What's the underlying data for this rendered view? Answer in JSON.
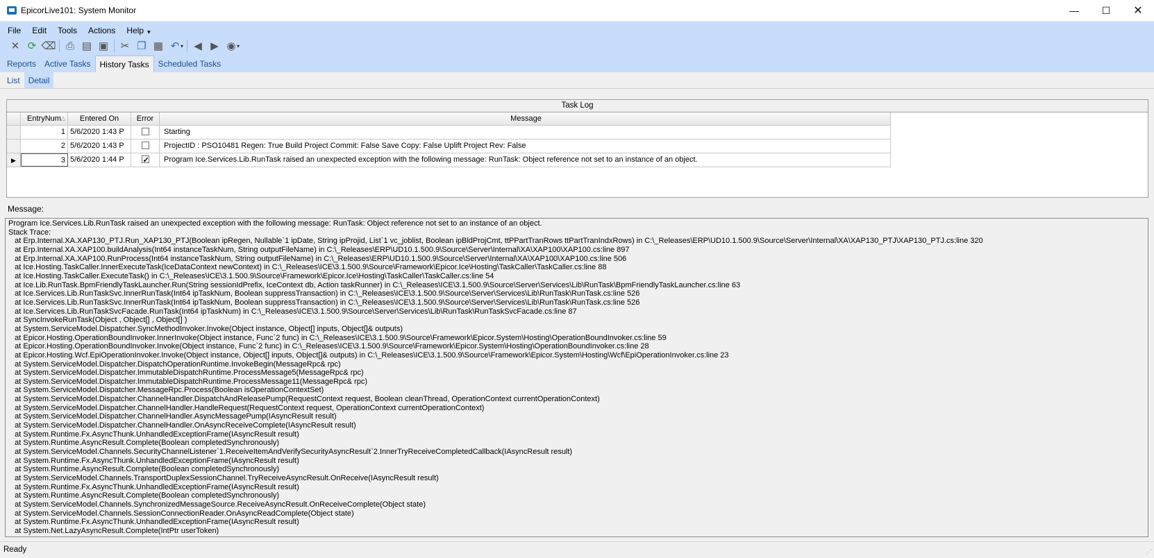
{
  "window": {
    "title": "EpicorLive101: System Monitor",
    "minimize_glyph": "—",
    "maximize_glyph": "☐",
    "close_glyph": "✕"
  },
  "menu": {
    "file": "File",
    "edit": "Edit",
    "tools": "Tools",
    "actions": "Actions",
    "help": "Help"
  },
  "toolbar": {
    "icons": [
      "delete-icon",
      "refresh-icon",
      "clear-icon",
      "print-icon",
      "print-preview-icon",
      "save-icon",
      "cut-icon",
      "copy-icon",
      "paste-icon",
      "undo-icon",
      "back-icon",
      "forward-icon",
      "home-icon"
    ]
  },
  "top_tabs": [
    {
      "label": "Reports"
    },
    {
      "label": "Active Tasks"
    },
    {
      "label": "History Tasks",
      "active": true
    },
    {
      "label": "Scheduled Tasks"
    }
  ],
  "sub_tabs": [
    {
      "label": "List"
    },
    {
      "label": "Detail",
      "active": true
    }
  ],
  "task_log": {
    "title": "Task Log",
    "columns": [
      "EntryNum",
      "Entered On",
      "Error",
      "Message"
    ],
    "rows": [
      {
        "entry": "1",
        "entered_on": "5/6/2020 1:43 P",
        "error": false,
        "message": "Starting"
      },
      {
        "entry": "2",
        "entered_on": "5/6/2020 1:43 P",
        "error": false,
        "message": "ProjectID : PSO10481 Regen: True Build Project Commit: False Save Copy: False Uplift Project Rev: False"
      },
      {
        "entry": "3",
        "entered_on": "5/6/2020 1:44 P",
        "error": true,
        "message": "Program Ice.Services.Lib.RunTask raised an unexpected exception with the following message: RunTask: Object reference not set to an instance of an object."
      }
    ]
  },
  "message": {
    "label": "Message:",
    "lines": [
      "Program Ice.Services.Lib.RunTask raised an unexpected exception with the following message: RunTask: Object reference not set to an instance of an object.",
      "Stack Trace:",
      "   at Erp.Internal.XA.XAP130_PTJ.Run_XAP130_PTJ(Boolean ipRegen, Nullable`1 ipDate, String ipProjid, List`1 vc_joblist, Boolean ipBldProjCmt, ttPPartTranRows ttPartTranIndxRows) in C:\\_Releases\\ERP\\UD10.1.500.9\\Source\\Server\\Internal\\XA\\XAP130_PTJ\\XAP130_PTJ.cs:line 320",
      "   at Erp.Internal.XA.XAP100.buildAnalysis(Int64 instanceTaskNum, String outputFileName) in C:\\_Releases\\ERP\\UD10.1.500.9\\Source\\Server\\Internal\\XA\\XAP100\\XAP100.cs:line 897",
      "   at Erp.Internal.XA.XAP100.RunProcess(Int64 instanceTaskNum, String outputFileName) in C:\\_Releases\\ERP\\UD10.1.500.9\\Source\\Server\\Internal\\XA\\XAP100\\XAP100.cs:line 506",
      "   at Ice.Hosting.TaskCaller.InnerExecuteTask(IceDataContext newContext) in C:\\_Releases\\ICE\\3.1.500.9\\Source\\Framework\\Epicor.Ice\\Hosting\\TaskCaller\\TaskCaller.cs:line 88",
      "   at Ice.Hosting.TaskCaller.ExecuteTask() in C:\\_Releases\\ICE\\3.1.500.9\\Source\\Framework\\Epicor.Ice\\Hosting\\TaskCaller\\TaskCaller.cs:line 54",
      "   at Ice.Lib.RunTask.BpmFriendlyTaskLauncher.Run(String sessionIdPrefix, IceContext db, Action taskRunner) in C:\\_Releases\\ICE\\3.1.500.9\\Source\\Server\\Services\\Lib\\RunTask\\BpmFriendlyTaskLauncher.cs:line 63",
      "   at Ice.Services.Lib.RunTaskSvc.InnerRunTask(Int64 ipTaskNum, Boolean suppressTransaction) in C:\\_Releases\\ICE\\3.1.500.9\\Source\\Server\\Services\\Lib\\RunTask\\RunTask.cs:line 526",
      "   at Ice.Services.Lib.RunTaskSvc.InnerRunTask(Int64 ipTaskNum, Boolean suppressTransaction) in C:\\_Releases\\ICE\\3.1.500.9\\Source\\Server\\Services\\Lib\\RunTask\\RunTask.cs:line 526",
      "   at Ice.Services.Lib.RunTaskSvcFacade.RunTask(Int64 ipTaskNum) in C:\\_Releases\\ICE\\3.1.500.9\\Source\\Server\\Services\\Lib\\RunTask\\RunTaskSvcFacade.cs:line 87",
      "   at SyncInvokeRunTask(Object , Object[] , Object[] )",
      "   at System.ServiceModel.Dispatcher.SyncMethodInvoker.Invoke(Object instance, Object[] inputs, Object[]& outputs)",
      "   at Epicor.Hosting.OperationBoundInvoker.InnerInvoke(Object instance, Func`2 func) in C:\\_Releases\\ICE\\3.1.500.9\\Source\\Framework\\Epicor.System\\Hosting\\OperationBoundInvoker.cs:line 59",
      "   at Epicor.Hosting.OperationBoundInvoker.Invoke(Object instance, Func`2 func) in C:\\_Releases\\ICE\\3.1.500.9\\Source\\Framework\\Epicor.System\\Hosting\\OperationBoundInvoker.cs:line 28",
      "   at Epicor.Hosting.Wcf.EpiOperationInvoker.Invoke(Object instance, Object[] inputs, Object[]& outputs) in C:\\_Releases\\ICE\\3.1.500.9\\Source\\Framework\\Epicor.System\\Hosting\\Wcf\\EpiOperationInvoker.cs:line 23",
      "   at System.ServiceModel.Dispatcher.DispatchOperationRuntime.InvokeBegin(MessageRpc& rpc)",
      "   at System.ServiceModel.Dispatcher.ImmutableDispatchRuntime.ProcessMessage5(MessageRpc& rpc)",
      "   at System.ServiceModel.Dispatcher.ImmutableDispatchRuntime.ProcessMessage11(MessageRpc& rpc)",
      "   at System.ServiceModel.Dispatcher.MessageRpc.Process(Boolean isOperationContextSet)",
      "   at System.ServiceModel.Dispatcher.ChannelHandler.DispatchAndReleasePump(RequestContext request, Boolean cleanThread, OperationContext currentOperationContext)",
      "   at System.ServiceModel.Dispatcher.ChannelHandler.HandleRequest(RequestContext request, OperationContext currentOperationContext)",
      "   at System.ServiceModel.Dispatcher.ChannelHandler.AsyncMessagePump(IAsyncResult result)",
      "   at System.ServiceModel.Dispatcher.ChannelHandler.OnAsyncReceiveComplete(IAsyncResult result)",
      "   at System.Runtime.Fx.AsyncThunk.UnhandledExceptionFrame(IAsyncResult result)",
      "   at System.Runtime.AsyncResult.Complete(Boolean completedSynchronously)",
      "   at System.ServiceModel.Channels.SecurityChannelListener`1.ReceiveItemAndVerifySecurityAsyncResult`2.InnerTryReceiveCompletedCallback(IAsyncResult result)",
      "   at System.Runtime.Fx.AsyncThunk.UnhandledExceptionFrame(IAsyncResult result)",
      "   at System.Runtime.AsyncResult.Complete(Boolean completedSynchronously)",
      "   at System.ServiceModel.Channels.TransportDuplexSessionChannel.TryReceiveAsyncResult.OnReceive(IAsyncResult result)",
      "   at System.Runtime.Fx.AsyncThunk.UnhandledExceptionFrame(IAsyncResult result)",
      "   at System.Runtime.AsyncResult.Complete(Boolean completedSynchronously)",
      "   at System.ServiceModel.Channels.SynchronizedMessageSource.ReceiveAsyncResult.OnReceiveComplete(Object state)",
      "   at System.ServiceModel.Channels.SessionConnectionReader.OnAsyncReadComplete(Object state)",
      "   at System.Runtime.Fx.AsyncThunk.UnhandledExceptionFrame(IAsyncResult result)",
      "   at System.Net.LazyAsyncResult.Complete(IntPtr userToken)"
    ]
  },
  "status": {
    "text": "Ready"
  }
}
